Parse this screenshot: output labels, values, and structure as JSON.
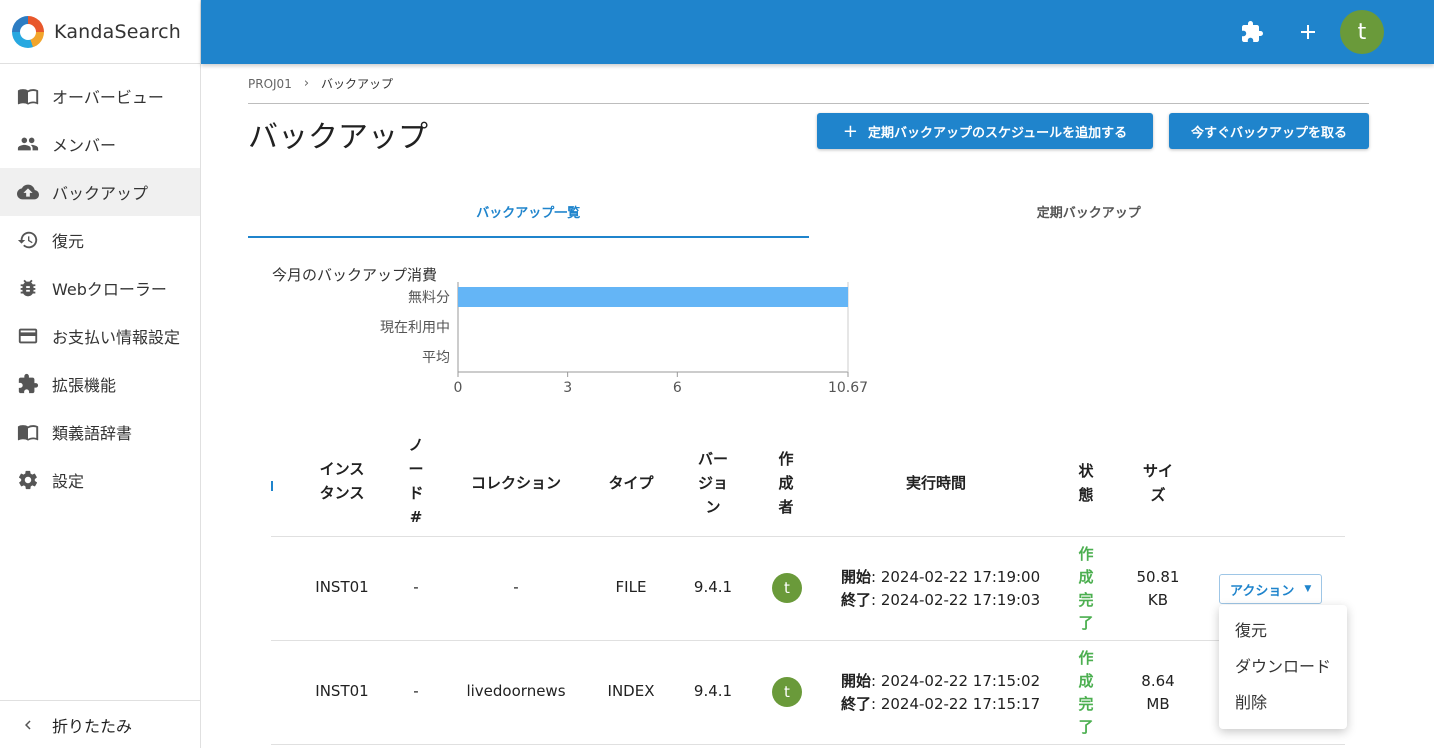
{
  "brand": {
    "name": "KandaSearch"
  },
  "sidebar": {
    "items": [
      {
        "label": "オーバービュー"
      },
      {
        "label": "メンバー"
      },
      {
        "label": "バックアップ"
      },
      {
        "label": "復元"
      },
      {
        "label": "Webクローラー"
      },
      {
        "label": "お支払い情報設定"
      },
      {
        "label": "拡張機能"
      },
      {
        "label": "類義語辞書"
      },
      {
        "label": "設定"
      }
    ],
    "collapse_label": "折りたたみ"
  },
  "header": {
    "avatar_initial": "t"
  },
  "breadcrumb": {
    "project": "PROJ01",
    "separator": "›",
    "current": "バックアップ"
  },
  "page": {
    "title": "バックアップ",
    "add_schedule_label": "定期バックアップのスケジュールを追加する",
    "backup_now_label": "今すぐバックアップを取る"
  },
  "tabs": [
    {
      "label": "バックアップ一覧"
    },
    {
      "label": "定期バックアップ"
    }
  ],
  "chart_data": {
    "type": "bar",
    "title": "今月のバックアップ消費",
    "orientation": "horizontal",
    "categories": [
      "無料分",
      "現在利用中",
      "平均"
    ],
    "values": [
      10.67,
      0,
      0
    ],
    "xlim": [
      0,
      10.67
    ],
    "xticks": [
      "0",
      "3",
      "6",
      "10.67"
    ],
    "bar_color": "#64b5f6"
  },
  "table": {
    "headers": {
      "instance": [
        "インス",
        "タンス"
      ],
      "node": [
        "ノ",
        "ー",
        "ド",
        "#"
      ],
      "collection": [
        "コレクション"
      ],
      "type": [
        "タイプ"
      ],
      "version": [
        "バー",
        "ジョ",
        "ン"
      ],
      "creator": [
        "作",
        "成",
        "者"
      ],
      "exec_time": [
        "実行時間"
      ],
      "status": [
        "状",
        "態"
      ],
      "size": [
        "サイ",
        "ズ"
      ]
    },
    "rows": [
      {
        "instance": "INST01",
        "node": "-",
        "collection": "-",
        "type": "FILE",
        "version": "9.4.1",
        "creator": "t",
        "start_label": "開始",
        "start": ": 2024-02-22 17:19:00",
        "end_label": "終了",
        "end": ": 2024-02-22 17:19:03",
        "status": [
          "作",
          "成",
          "完",
          "了"
        ],
        "size": [
          "50.81",
          "KB"
        ],
        "action_label": "アクション"
      },
      {
        "instance": "INST01",
        "node": "-",
        "collection": "livedoornews",
        "type": "INDEX",
        "version": "9.4.1",
        "creator": "t",
        "start_label": "開始",
        "start": ": 2024-02-22 17:15:02",
        "end_label": "終了",
        "end": ": 2024-02-22 17:15:17",
        "status": [
          "作",
          "成",
          "完",
          "了"
        ],
        "size": [
          "8.64",
          "MB"
        ]
      }
    ]
  },
  "action_menu": {
    "items": [
      {
        "label": "復元"
      },
      {
        "label": "ダウンロード"
      },
      {
        "label": "削除"
      }
    ]
  },
  "colors": {
    "primary": "#1f84cc",
    "success": "#4caf50",
    "avatar": "#6a9a3a"
  }
}
